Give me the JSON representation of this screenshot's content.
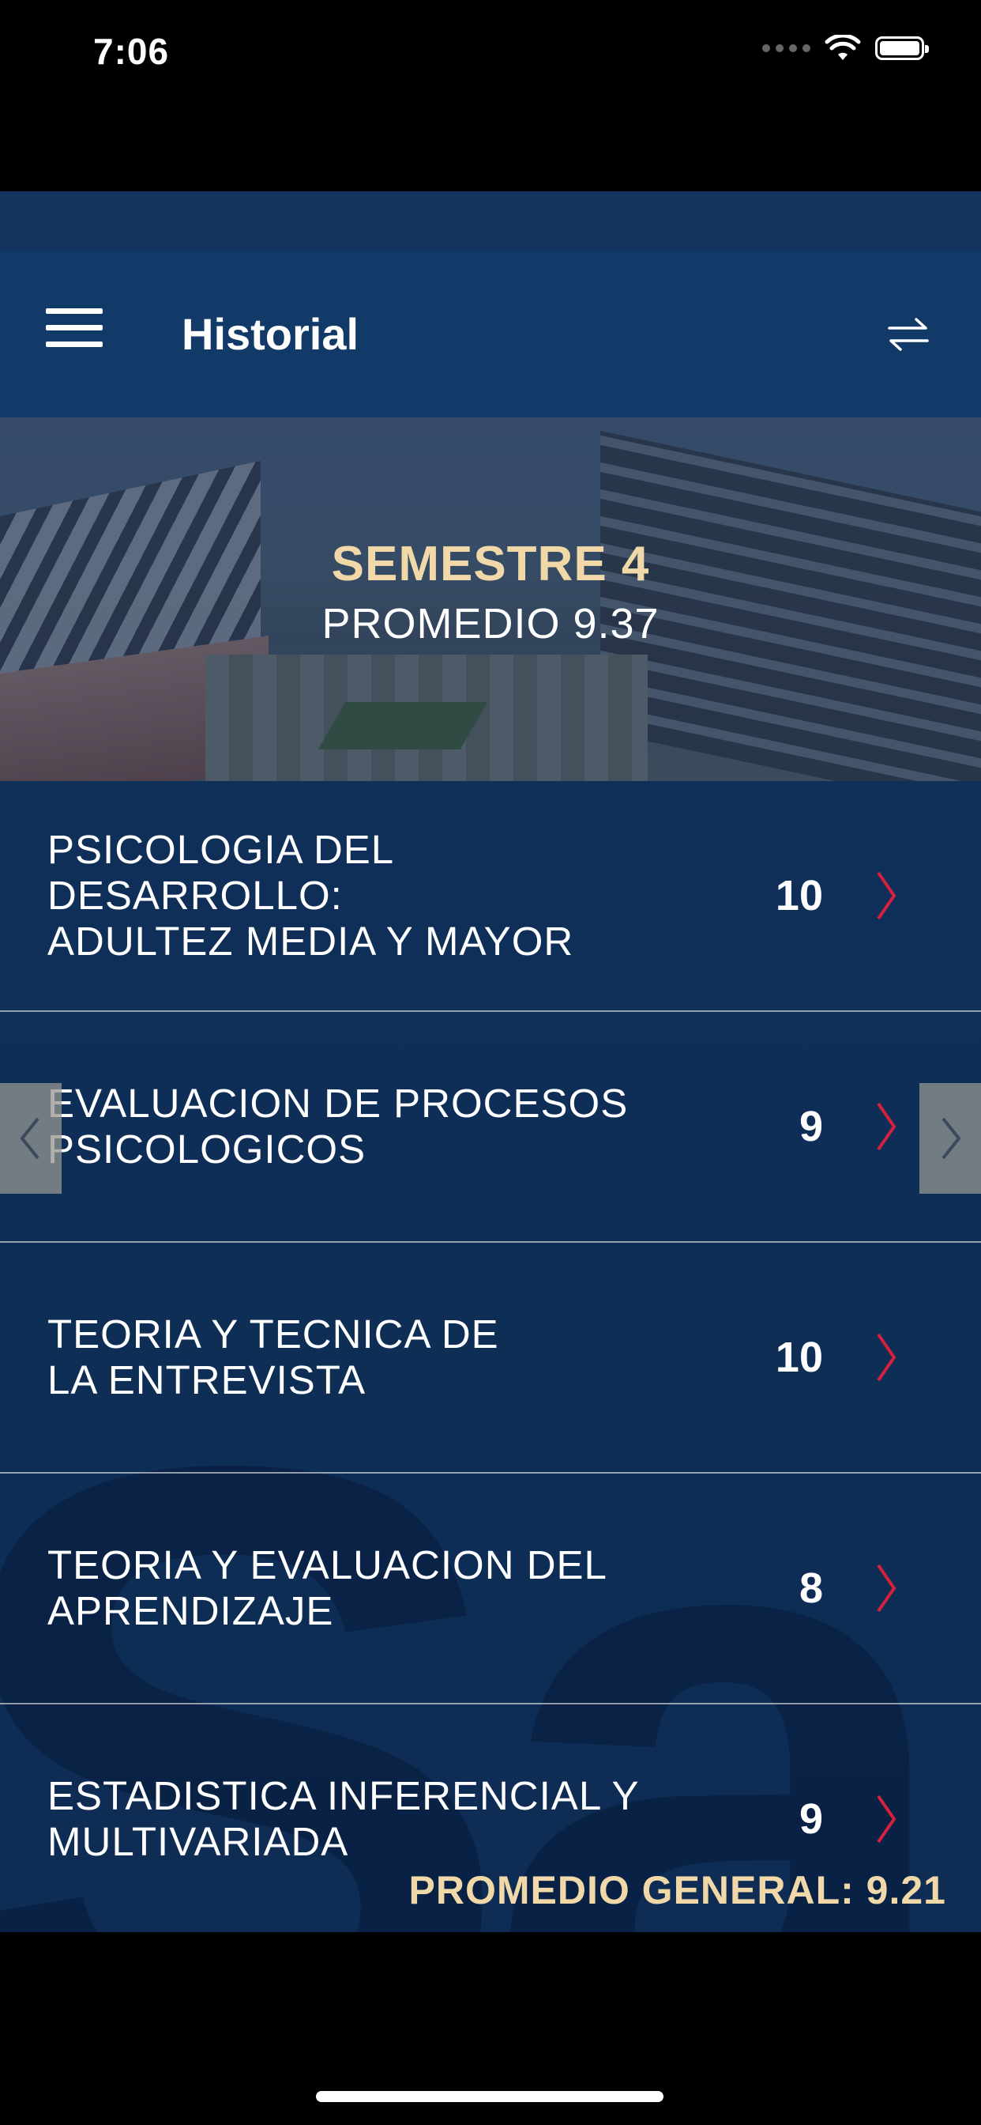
{
  "status_bar": {
    "time": "7:06"
  },
  "header": {
    "title": "Historial"
  },
  "hero": {
    "semester": "SEMESTRE 4",
    "average": "PROMEDIO 9.37"
  },
  "subjects": [
    {
      "name": "PSICOLOGIA DEL DESARROLLO:\nADULTEZ MEDIA Y MAYOR",
      "grade": "10"
    },
    {
      "name": "EVALUACION DE PROCESOS\nPSICOLOGICOS",
      "grade": "9"
    },
    {
      "name": "TEORIA Y TECNICA DE\nLA ENTREVISTA",
      "grade": "10"
    },
    {
      "name": "TEORIA Y EVALUACION DEL\nAPRENDIZAJE",
      "grade": "8"
    },
    {
      "name": "ESTADISTICA INFERENCIAL Y\nMULTIVARIADA",
      "grade": "9"
    }
  ],
  "footer": {
    "general_average": "PROMEDIO GENERAL: 9.21"
  },
  "colors": {
    "accent_gold": "#f0d8a8",
    "chevron_red": "#d4213d",
    "background_navy": "#0f2f58"
  },
  "icons": [
    "menu-icon",
    "swap-icon",
    "chevron-right-icon",
    "arrow-left-icon",
    "arrow-right-icon",
    "wifi-icon",
    "battery-icon"
  ]
}
